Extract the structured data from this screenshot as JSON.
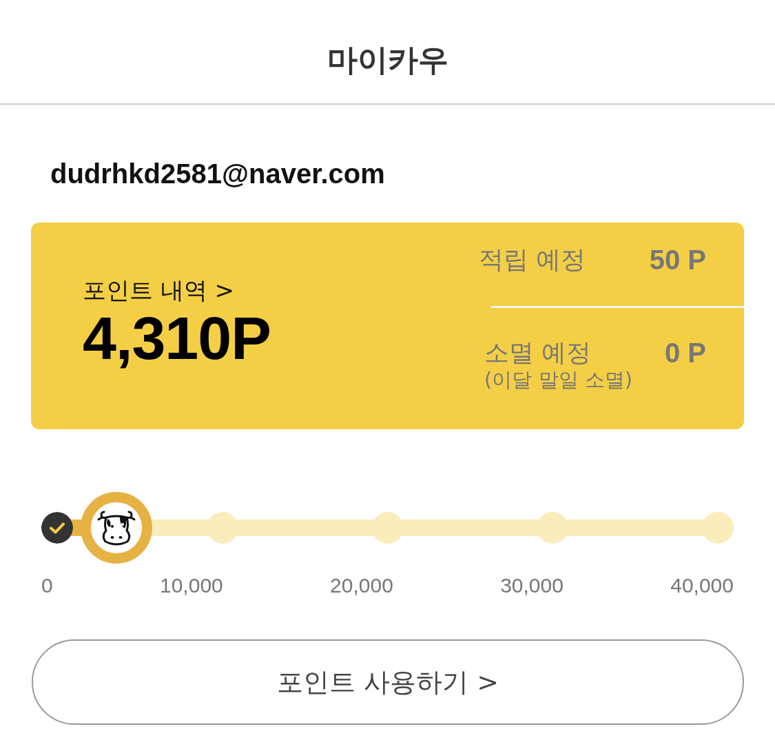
{
  "header": {
    "title": "마이카우"
  },
  "account": {
    "email": "dudrhkd2581@naver.com"
  },
  "points_card": {
    "history_link": "포인트 내역 >",
    "balance": "4,310P",
    "summary": [
      {
        "label": "적립 예정",
        "value": "50 P"
      },
      {
        "label": "소멸 예정",
        "note": "(이달 말일 소멸)",
        "value": "0 P"
      }
    ]
  },
  "progress": {
    "level": 0.108,
    "milestones": [
      {
        "label": "0",
        "reached": true
      },
      {
        "label": "10,000",
        "reached": false
      },
      {
        "label": "20,000",
        "reached": false
      },
      {
        "label": "30,000",
        "reached": false
      },
      {
        "label": "40,000",
        "reached": false
      }
    ]
  },
  "use_button": {
    "label": "포인트 사용하기 >"
  }
}
